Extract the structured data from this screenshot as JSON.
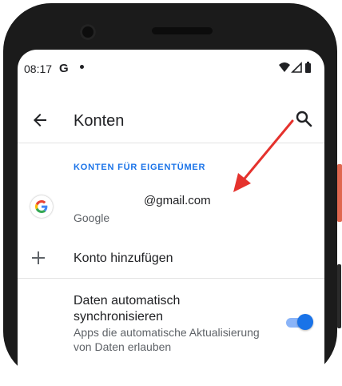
{
  "statusbar": {
    "time": "08:17",
    "app_icon": "G",
    "icons": [
      "wifi-icon",
      "cell-signal-icon",
      "battery-icon"
    ]
  },
  "appbar": {
    "title": "Konten",
    "back_icon": "arrow-back-icon",
    "search_icon": "search-icon"
  },
  "section": {
    "header": "KONTEN FÜR EIGENTÜMER"
  },
  "account": {
    "email": "@gmail.com",
    "type": "Google",
    "icon": "google-logo-icon"
  },
  "add_account": {
    "label": "Konto hinzufügen",
    "icon": "plus-icon"
  },
  "sync": {
    "title": "Daten automatisch synchronisieren",
    "subtitle": "Apps die automatische Aktualisierung von Daten erlauben",
    "enabled": true
  },
  "colors": {
    "accent": "#1a73e8",
    "arrow": "#e5322d",
    "side_button": "#e0674f"
  },
  "annotation": {
    "arrow_icon": "red-arrow-icon"
  }
}
